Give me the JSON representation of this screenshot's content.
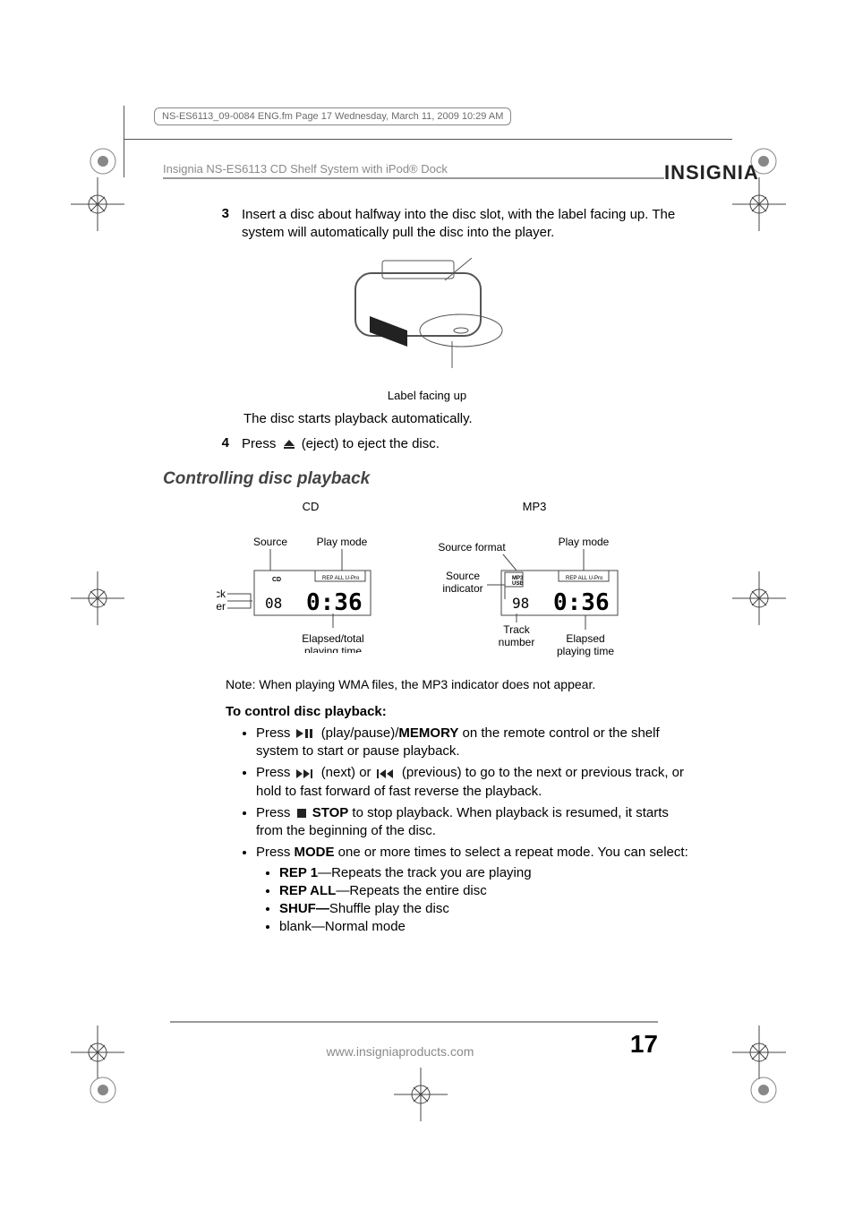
{
  "meta": {
    "header_line": "NS-ES6113_09-0084 ENG.fm  Page 17  Wednesday, March 11, 2009  10:29 AM",
    "product_title": "Insignia NS-ES6113 CD Shelf System with iPod® Dock",
    "brand": "INSIGNIA"
  },
  "steps": {
    "s3_num": "3",
    "s3_text": "Insert a disc about halfway into the disc slot, with the label facing up. The system will automatically pull the disc into the player.",
    "label_facing": "Label facing up",
    "auto_playback": "The disc starts playback automatically.",
    "s4_num": "4",
    "s4_press": "Press ",
    "s4_eject": " (eject) to eject the disc."
  },
  "section": {
    "heading": "Controlling disc playback",
    "cd_title": "CD",
    "mp3_title": "MP3",
    "cd_labels": {
      "source": "Source",
      "playmode": "Play mode",
      "track": "Track number",
      "elapsed": "Elapsed/total playing time"
    },
    "mp3_labels": {
      "source_format": "Source format",
      "playmode": "Play mode",
      "source_indicator": "Source indicator",
      "track": "Track number",
      "elapsed": "Elapsed playing time"
    },
    "note": "Note: When playing WMA files, the MP3 indicator does not appear.",
    "control_heading": "To control disc playback:",
    "b1_a": "Press ",
    "b1_b": " (play/pause)/",
    "b1_bold": "MEMORY",
    "b1_c": " on the remote control or the shelf system to start or pause playback.",
    "b2_a": "Press ",
    "b2_b": " (next) or ",
    "b2_c": " (previous) to go to the next or previous track, or hold to fast forward of fast reverse the playback.",
    "b3_a": "Press ",
    "b3_stop_bold": "STOP",
    "b3_b": " to stop playback. When playback is resumed, it starts from the beginning of the disc.",
    "b4_a": "Press ",
    "b4_mode_bold": "MODE",
    "b4_b": " one or more times to select a repeat mode. You can select:",
    "sub": {
      "rep1_bold": "REP 1",
      "rep1_txt": "—Repeats the track you are playing",
      "repall_bold": "REP ALL",
      "repall_txt": "—Repeats the entire disc",
      "shuf_bold": "SHUF—",
      "shuf_txt": "Shuffle play the disc",
      "blank": "blank—Normal mode"
    }
  },
  "footer": {
    "url": "www.insigniaproducts.com",
    "page": "17"
  }
}
